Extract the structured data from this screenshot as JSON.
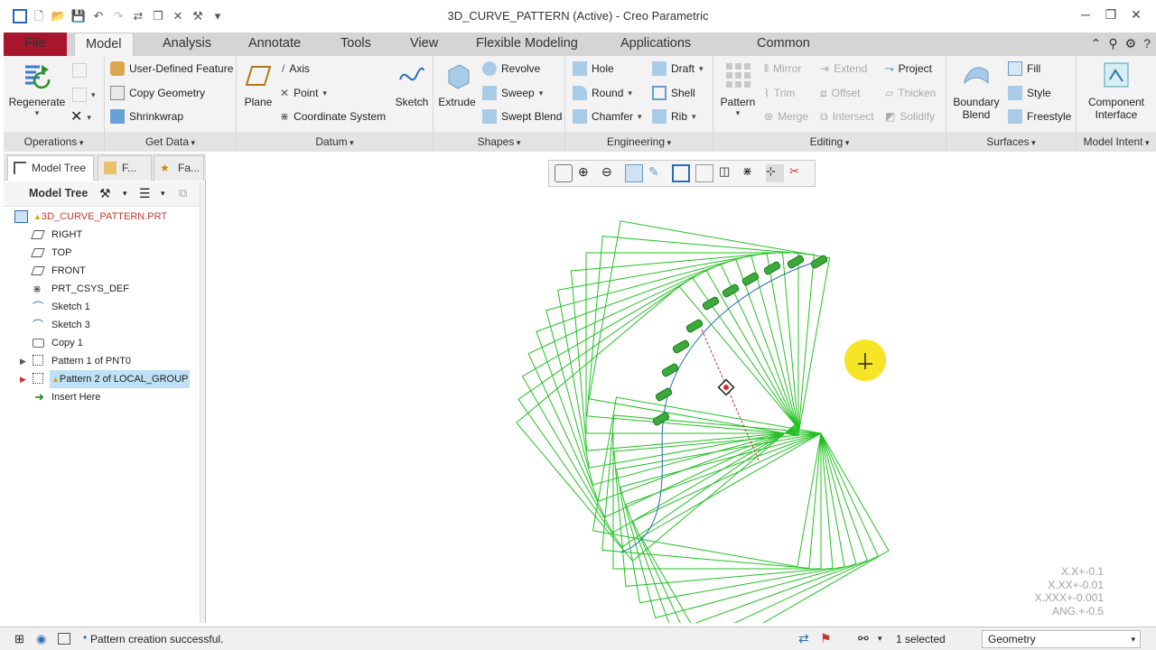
{
  "window": {
    "title": "3D_CURVE_PATTERN (Active) - Creo Parametric",
    "controls": [
      "─",
      "❐",
      "✕"
    ]
  },
  "tabs": {
    "file": "File",
    "items": [
      "Model",
      "Analysis",
      "Annotate",
      "Tools",
      "View",
      "Flexible Modeling",
      "Applications",
      "Common"
    ]
  },
  "ribbon": {
    "operations": {
      "label": "Operations",
      "regenerate": "Regenerate"
    },
    "get_data": {
      "label": "Get Data",
      "udf": "User-Defined Feature",
      "copy_geometry": "Copy Geometry",
      "shrinkwrap": "Shrinkwrap"
    },
    "datum": {
      "label": "Datum",
      "plane": "Plane",
      "axis": "Axis",
      "point": "Point",
      "csys": "Coordinate System",
      "sketch": "Sketch"
    },
    "shapes": {
      "label": "Shapes",
      "extrude": "Extrude",
      "revolve": "Revolve",
      "sweep": "Sweep",
      "swept_blend": "Swept Blend"
    },
    "engineering": {
      "label": "Engineering",
      "hole": "Hole",
      "round": "Round",
      "chamfer": "Chamfer",
      "draft": "Draft",
      "shell": "Shell",
      "rib": "Rib"
    },
    "editing": {
      "label": "Editing",
      "pattern": "Pattern",
      "mirror": "Mirror",
      "trim": "Trim",
      "merge": "Merge",
      "extend": "Extend",
      "offset": "Offset",
      "intersect": "Intersect",
      "project": "Project",
      "thicken": "Thicken",
      "solidify": "Solidify"
    },
    "surfaces": {
      "label": "Surfaces",
      "boundary_blend_1": "Boundary",
      "boundary_blend_2": "Blend",
      "fill": "Fill",
      "style": "Style",
      "freestyle": "Freestyle"
    },
    "model_intent": {
      "label": "Model Intent",
      "component_1": "Component",
      "component_2": "Interface"
    }
  },
  "panel": {
    "tabs": [
      "Model Tree",
      "F...",
      "Fa..."
    ],
    "toolbar_title": "Model Tree",
    "tree": [
      {
        "label": "3D_CURVE_PATTERN.PRT",
        "icon": "part-icon",
        "color": "#c0392b"
      },
      {
        "label": "RIGHT",
        "icon": "datum-plane-icon"
      },
      {
        "label": "TOP",
        "icon": "datum-plane-icon"
      },
      {
        "label": "FRONT",
        "icon": "datum-plane-icon"
      },
      {
        "label": "PRT_CSYS_DEF",
        "icon": "csys-icon"
      },
      {
        "label": "Sketch 1",
        "icon": "sketch-icon"
      },
      {
        "label": "Sketch 3",
        "icon": "sketch-icon"
      },
      {
        "label": "Copy 1",
        "icon": "copy-icon"
      },
      {
        "label": "Pattern 1 of PNT0",
        "icon": "pattern-icon"
      },
      {
        "label": "Pattern 2 of LOCAL_GROUP",
        "icon": "pattern-icon"
      },
      {
        "label": "Insert Here",
        "icon": "insert-arrow-icon"
      }
    ]
  },
  "graphics": {
    "tolerances": [
      "X.X+-0.1",
      "X.XX+-0.01",
      "X.XXX+-0.001",
      "ANG.+-0.5"
    ]
  },
  "status": {
    "message": "Pattern creation successful.",
    "selected": "1 selected",
    "filter_value": "Geometry"
  },
  "colors": {
    "file_tab": "#a7162d",
    "wireframe": "#22c022",
    "selection": "#bfe0f6",
    "cursor_highlight": "#f5e000"
  }
}
